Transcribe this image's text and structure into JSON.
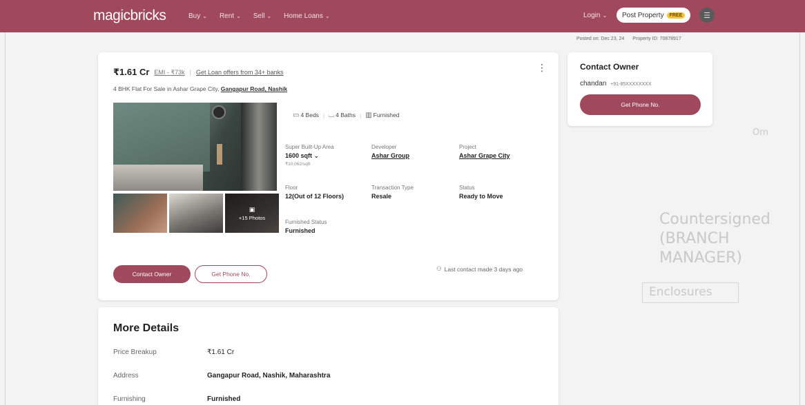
{
  "header": {
    "logo": "magicbricks",
    "nav": [
      "Buy",
      "Rent",
      "Sell",
      "Home Loans"
    ],
    "login": "Login",
    "post_property": "Post Property",
    "free_badge": "FREE"
  },
  "meta": {
    "posted_on": "Posted on: Dec 23, 24",
    "property_id": "Property ID: 70878917"
  },
  "listing": {
    "price": "₹1.61 Cr",
    "emi": "EMI - ₹73k",
    "separator": "|",
    "loan_offers": "Get Loan offers from 34+ banks",
    "subtitle_prefix": "4 BHK Flat For Sale in Ashar Grape City,",
    "subtitle_location": "Gangapur Road, Nashik",
    "more_photos": "+15 Photos",
    "amenities": {
      "beds": "4 Beds",
      "baths": "4 Baths",
      "furnished": "Furnished"
    },
    "specs": {
      "area_label": "Super Built-Up Area",
      "area_value": "1600 sqft",
      "area_rate": "₹10,062/sqft",
      "developer_label": "Developer",
      "developer_value": "Ashar Group",
      "project_label": "Project",
      "project_value": "Ashar Grape City",
      "floor_label": "Floor",
      "floor_value": "12(Out of 12 Floors)",
      "transaction_label": "Transaction Type",
      "transaction_value": "Resale",
      "status_label": "Status",
      "status_value": "Ready to Move",
      "furnished_label": "Furnished Status",
      "furnished_value": "Furnished"
    },
    "contact_owner_btn": "Contact Owner",
    "get_phone_btn": "Get Phone No.",
    "last_contact": "Last contact made 3 days ago"
  },
  "owner": {
    "title": "Contact Owner",
    "name": "chandan",
    "phone": "+91-85XXXXXXXX",
    "button": "Get Phone No."
  },
  "details": {
    "title": "More Details",
    "rows": [
      {
        "key": "Price Breakup",
        "value": "₹1.61 Cr"
      },
      {
        "key": "Address",
        "value": "Gangapur Road, Nashik, Maharashtra"
      },
      {
        "key": "Furnishing",
        "value": "Furnished"
      }
    ]
  },
  "background_bleed": {
    "line1": "Countersigned",
    "line2": "(BRANCH MANAGER)",
    "line3": "Enclosures",
    "line4": "Om"
  }
}
